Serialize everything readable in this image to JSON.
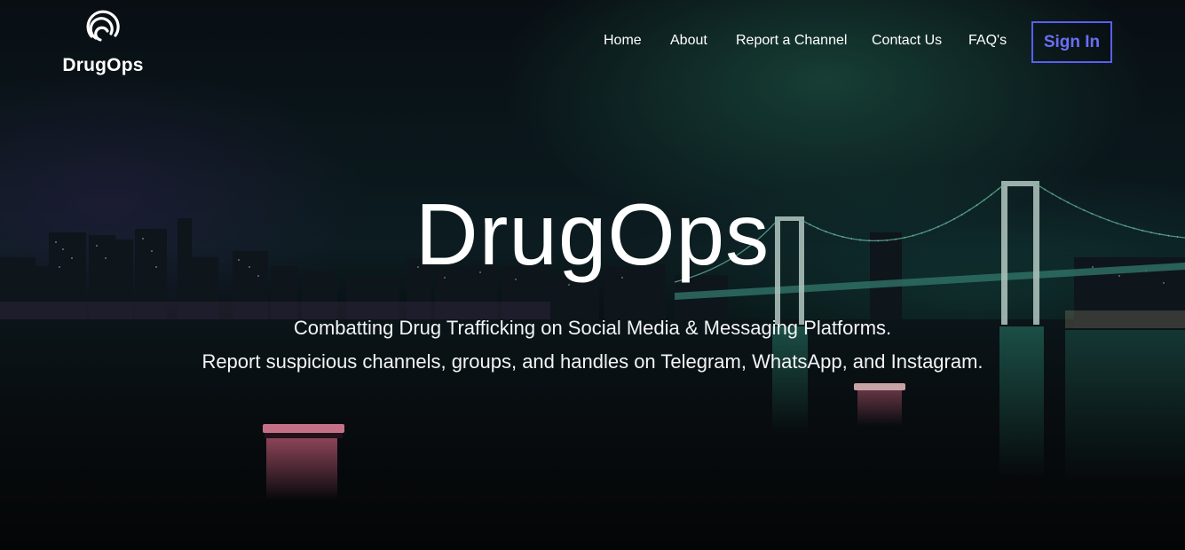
{
  "brand": {
    "name": "DrugOps",
    "icon": "fingerprint-logo-icon"
  },
  "nav": {
    "items": [
      {
        "label": "Home"
      },
      {
        "label": "About"
      },
      {
        "label": "Report a Channel"
      },
      {
        "label": "Contact Us"
      },
      {
        "label": "FAQ's"
      }
    ],
    "signin_label": "Sign In"
  },
  "hero": {
    "title": "DrugOps",
    "tagline_1": "Combatting Drug Trafficking on Social Media & Messaging Platforms.",
    "tagline_2": "Report suspicious channels, groups, and handles on Telegram, WhatsApp, and Instagram.",
    "background": "night-city-bridge-image"
  },
  "colors": {
    "accent": "#5a5ff0",
    "text": "#ffffff",
    "bridge_glow": "#2f9e86"
  }
}
